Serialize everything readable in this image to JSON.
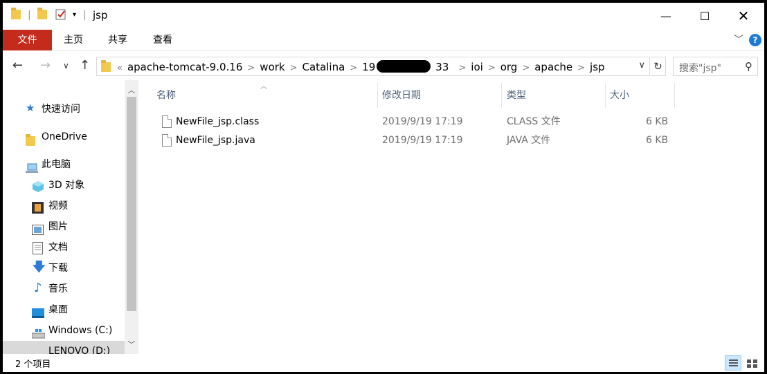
{
  "window": {
    "title": "jsp"
  },
  "ribbon": {
    "tabs": [
      "文件",
      "主页",
      "共享",
      "查看"
    ]
  },
  "address": {
    "overflow": "«",
    "crumbs": [
      "apache-tomcat-9.0.16",
      "work",
      "Catalina",
      "19",
      "33",
      "ioi",
      "org",
      "apache",
      "jsp"
    ],
    "search_placeholder": "搜索\"jsp\""
  },
  "nav": {
    "items": [
      {
        "label": "快速访问",
        "icon": "star-icon"
      },
      {
        "label": "OneDrive",
        "icon": "folder-icon"
      },
      {
        "label": "此电脑",
        "icon": "computer-icon"
      },
      {
        "label": "3D 对象",
        "icon": "cube-icon"
      },
      {
        "label": "视频",
        "icon": "video-icon"
      },
      {
        "label": "图片",
        "icon": "picture-icon"
      },
      {
        "label": "文档",
        "icon": "document-icon"
      },
      {
        "label": "下载",
        "icon": "download-icon"
      },
      {
        "label": "音乐",
        "icon": "music-icon"
      },
      {
        "label": "桌面",
        "icon": "desktop-icon"
      },
      {
        "label": "Windows (C:)",
        "icon": "drive-icon"
      },
      {
        "label": "LENOVO (D:)",
        "icon": "drive-icon"
      }
    ]
  },
  "columns": {
    "name": "名称",
    "modified": "修改日期",
    "type": "类型",
    "size": "大小"
  },
  "files": [
    {
      "name": "NewFile_jsp.class",
      "modified": "2019/9/19 17:19",
      "type": "CLASS 文件",
      "size": "6 KB"
    },
    {
      "name": "NewFile_jsp.java",
      "modified": "2019/9/19 17:19",
      "type": "JAVA 文件",
      "size": "6 KB"
    }
  ],
  "status": {
    "count": "2 个项目"
  },
  "colors": {
    "file_tab": "#c42b1c",
    "selected_nav": "#d9d9d9",
    "header_text": "#4c607a"
  }
}
